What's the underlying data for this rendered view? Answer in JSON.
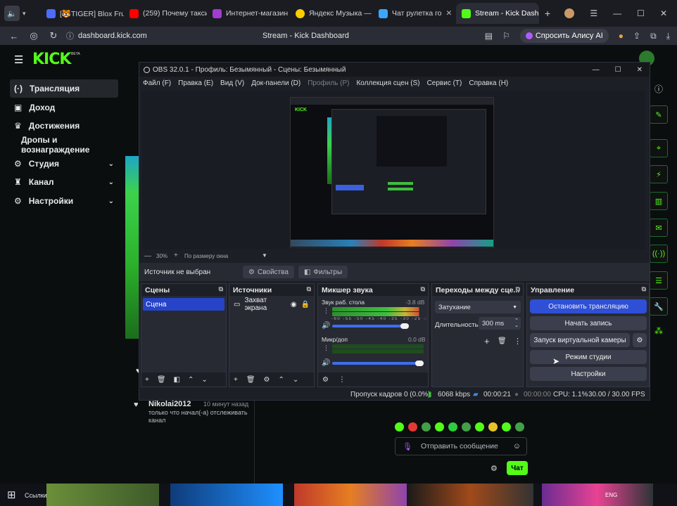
{
  "browser": {
    "tabs": [
      {
        "label": "[🐯TIGER] Blox Fruit",
        "color": "#4b6cff"
      },
      {
        "label": "(259) Почему такси",
        "color": "#ff0000"
      },
      {
        "label": "Интернет-магазин W",
        "color": "#a23bd1"
      },
      {
        "label": "Яндекс Музыка — со",
        "color": "#ffcc00"
      },
      {
        "label": "Чат рулетка го",
        "color": "#3aa6ff"
      },
      {
        "label": "Stream - Kick Dash",
        "color": "#53fc18"
      }
    ],
    "url": "dashboard.kick.com",
    "page_title": "Stream - Kick Dashboard",
    "alice_label": "Спросить Алису AI"
  },
  "kick": {
    "logo": "KICK",
    "logo_beta": "BETA",
    "sidebar": [
      {
        "label": "Трансляция",
        "icon": "broadcast-icon"
      },
      {
        "label": "Доход",
        "icon": "money-icon"
      },
      {
        "label": "Достижения",
        "icon": "trophy-icon"
      },
      {
        "label": "Дропы и вознаграждение",
        "icon": ""
      },
      {
        "label": "Студия",
        "icon": "studio-icon"
      },
      {
        "label": "Канал",
        "icon": "channel-icon"
      },
      {
        "label": "Настройки",
        "icon": "gear-icon"
      }
    ],
    "chat": {
      "user": "Nikolai2012",
      "time": "10 минут назад",
      "message": "только что начал(-а) отслеживать канал",
      "input_placeholder": "Отправить сообщение",
      "send_label": "Чат"
    }
  },
  "obs": {
    "title": "OBS 32.0.1 - Профиль: Безымянный - Сцены: Безымянный",
    "menu": [
      "Файл (F)",
      "Правка (E)",
      "Вид (V)",
      "Док-панели (D)",
      "Профиль (P)",
      "Коллекция сцен (S)",
      "Сервис (T)",
      "Справка (H)"
    ],
    "zoom": "30%",
    "zoom_mode": "По размеру окна",
    "no_source": "Источник не выбран",
    "properties": "Свойства",
    "filters": "Фильтры",
    "docks": {
      "scenes": {
        "title": "Сцены",
        "items": [
          "Сцена"
        ]
      },
      "sources": {
        "title": "Источники",
        "items": [
          "Захват экрана"
        ]
      },
      "mixer": {
        "title": "Микшер звука",
        "channels": [
          {
            "name": "Звук раб. стола",
            "db": "-3.8 dB",
            "level": 0.95
          },
          {
            "name": "Микр/доп",
            "db": "0.0 dB",
            "level": 1.0
          }
        ],
        "scale": "-60 -55 -50 -45 -40 -35 -30 -25 -20 -15 -10 -5 0"
      },
      "transitions": {
        "title": "Переходы между сце...",
        "type": "Затухание",
        "duration_label": "Длительность",
        "duration": "300 ms"
      },
      "controls": {
        "title": "Управление",
        "buttons": [
          "Остановить трансляцию",
          "Начать запись",
          "Запуск виртуальной камеры",
          "Режим студии",
          "Настройки"
        ]
      }
    },
    "status": {
      "dropped": "Пропуск кадров 0 (0.0%)",
      "bitrate": "6068 kbps",
      "stream_time": "00:00:21",
      "rec_time": "00:00:00",
      "cpu": "CPU: 1.1%",
      "fps": "30.00 / 30.00 FPS"
    }
  },
  "taskbar": {
    "links_label": "Ссылки",
    "lang": "ENG"
  },
  "colors": {
    "kick_green": "#53fc18",
    "obs_blue": "#3c5fe0"
  }
}
